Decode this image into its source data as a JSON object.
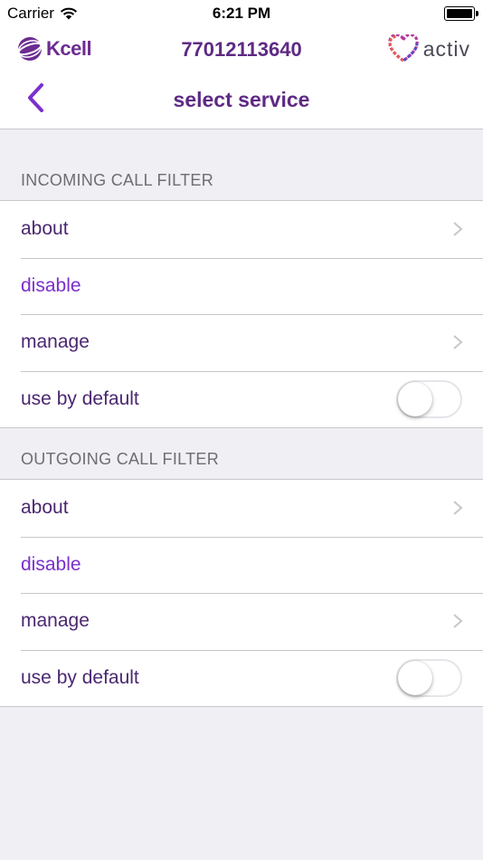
{
  "status_bar": {
    "carrier": "Carrier",
    "time": "6:21 PM"
  },
  "brand_bar": {
    "left_logo": "Kcell",
    "phone_number": "77012113640",
    "right_logo": "activ"
  },
  "nav": {
    "title": "select service",
    "back_icon": "chevron-left-icon"
  },
  "colors": {
    "accent": "#7b2fcc",
    "brand": "#5e2a84",
    "background": "#efeff4"
  },
  "sections": [
    {
      "header": "INCOMING CALL FILTER",
      "rows": [
        {
          "label": "about"
        },
        {
          "label": "disable"
        },
        {
          "label": "manage"
        },
        {
          "label": "use by default",
          "toggle_on": false
        }
      ]
    },
    {
      "header": "OUTGOING CALL FILTER",
      "rows": [
        {
          "label": "about"
        },
        {
          "label": "disable"
        },
        {
          "label": "manage"
        },
        {
          "label": "use by default",
          "toggle_on": false
        }
      ]
    }
  ]
}
